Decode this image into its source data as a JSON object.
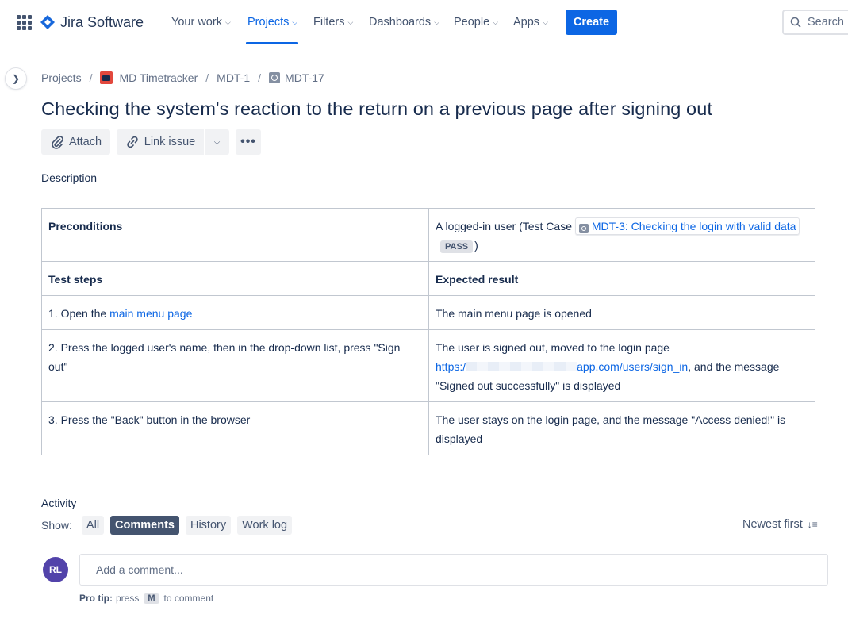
{
  "app": {
    "name": "Jira Software"
  },
  "nav": {
    "items": [
      {
        "label": "Your work"
      },
      {
        "label": "Projects"
      },
      {
        "label": "Filters"
      },
      {
        "label": "Dashboards"
      },
      {
        "label": "People"
      },
      {
        "label": "Apps"
      }
    ],
    "create_label": "Create",
    "search_placeholder": "Search"
  },
  "breadcrumbs": {
    "root": "Projects",
    "project": "MD Timetracker",
    "parent": "MDT-1",
    "issue": "MDT-17"
  },
  "issue": {
    "title": "Checking the system's reaction to the return on a previous page after signing out"
  },
  "toolbar": {
    "attach_label": "Attach",
    "link_issue_label": "Link issue"
  },
  "description": {
    "label": "Description",
    "preconditions_label": "Preconditions",
    "preconditions_prefix": "A logged-in user (Test Case",
    "linked_issue": "MDT-3: Checking the login with valid data",
    "linked_status": "PASS",
    "preconditions_suffix": ")",
    "col_steps": "Test steps",
    "col_expected": "Expected result",
    "step1_prefix": "1. Open the ",
    "step1_link": "main menu page",
    "result1": "The main menu page is opened",
    "step2": "2. Press the logged user's name, then in the drop-down list, press \"Sign out\"",
    "result2_line1": "The user is signed out, moved to the login page",
    "result2_link_start": "https:/",
    "result2_link_end": "app.com/users/sign_in",
    "result2_rest": ", and the message",
    "result2_line3": "\"Signed out successfully\" is displayed",
    "step3": "3. Press the \"Back\" button in the browser",
    "result3": "The user stays on the login page, and the message \"Access denied!\" is displayed"
  },
  "activity": {
    "label": "Activity",
    "show_label": "Show:",
    "filters": [
      {
        "label": "All",
        "selected": false
      },
      {
        "label": "Comments",
        "selected": true
      },
      {
        "label": "History",
        "selected": false
      },
      {
        "label": "Work log",
        "selected": false
      }
    ],
    "sort_label": "Newest first",
    "avatar_initials": "RL",
    "comment_placeholder": "Add a comment...",
    "protip_label": "Pro tip:",
    "protip_text_before": "press",
    "protip_key": "M",
    "protip_text_after": "to comment"
  },
  "colors": {
    "accent": "#0c66e4",
    "avatar": "#5243aa",
    "project_icon": "#e2483d"
  }
}
